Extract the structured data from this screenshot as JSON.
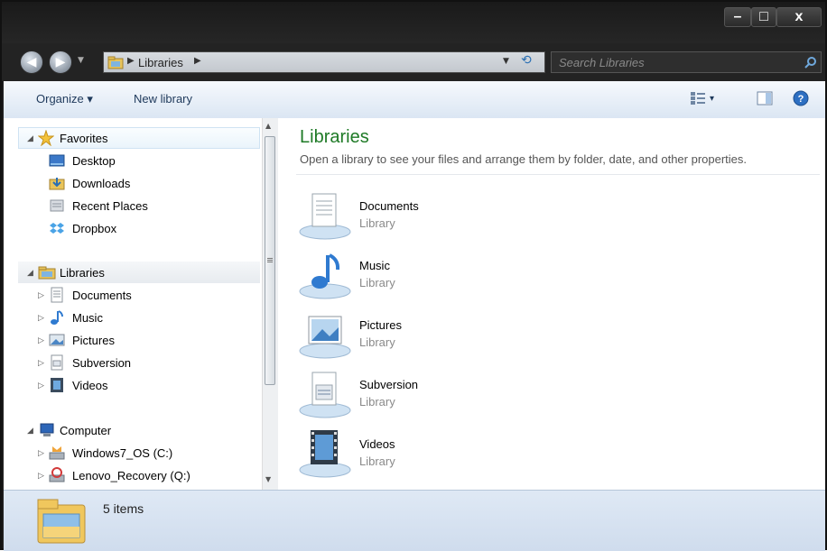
{
  "window": {
    "controls": {
      "minimize": "–",
      "maximize": "□",
      "close": "x"
    }
  },
  "address_bar": {
    "path": [
      "Libraries"
    ],
    "search_placeholder": "Search Libraries"
  },
  "toolbar": {
    "organize_label": "Organize ▾",
    "new_library_label": "New library",
    "views_label": "▾"
  },
  "nav_pane": {
    "favorites": {
      "label": "Favorites",
      "items": [
        {
          "label": "Desktop",
          "icon": "desktop-icon"
        },
        {
          "label": "Downloads",
          "icon": "downloads-icon"
        },
        {
          "label": "Recent Places",
          "icon": "recent-places-icon"
        },
        {
          "label": "Dropbox",
          "icon": "dropbox-icon"
        }
      ]
    },
    "libraries": {
      "label": "Libraries",
      "items": [
        {
          "label": "Documents",
          "icon": "documents-icon"
        },
        {
          "label": "Music",
          "icon": "music-icon"
        },
        {
          "label": "Pictures",
          "icon": "pictures-icon"
        },
        {
          "label": "Subversion",
          "icon": "subversion-icon"
        },
        {
          "label": "Videos",
          "icon": "videos-icon"
        }
      ]
    },
    "computer": {
      "label": "Computer",
      "items": [
        {
          "label": "Windows7_OS (C:)",
          "icon": "drive-icon"
        },
        {
          "label": "Lenovo_Recovery (Q:)",
          "icon": "recovery-drive-icon"
        }
      ]
    }
  },
  "content": {
    "title": "Libraries",
    "subtitle": "Open a library to see your files and arrange them by folder, date, and other properties.",
    "libraries": [
      {
        "name": "Documents",
        "type": "Library",
        "icon": "documents-library-icon"
      },
      {
        "name": "Music",
        "type": "Library",
        "icon": "music-library-icon"
      },
      {
        "name": "Pictures",
        "type": "Library",
        "icon": "pictures-library-icon"
      },
      {
        "name": "Subversion",
        "type": "Library",
        "icon": "subversion-library-icon"
      },
      {
        "name": "Videos",
        "type": "Library",
        "icon": "videos-library-icon"
      }
    ]
  },
  "status_bar": {
    "item_count": "5 items"
  },
  "colors": {
    "title_green": "#1e7a26",
    "toolbar_text": "#1e395b",
    "selection_bg": "#e5f3fb"
  }
}
